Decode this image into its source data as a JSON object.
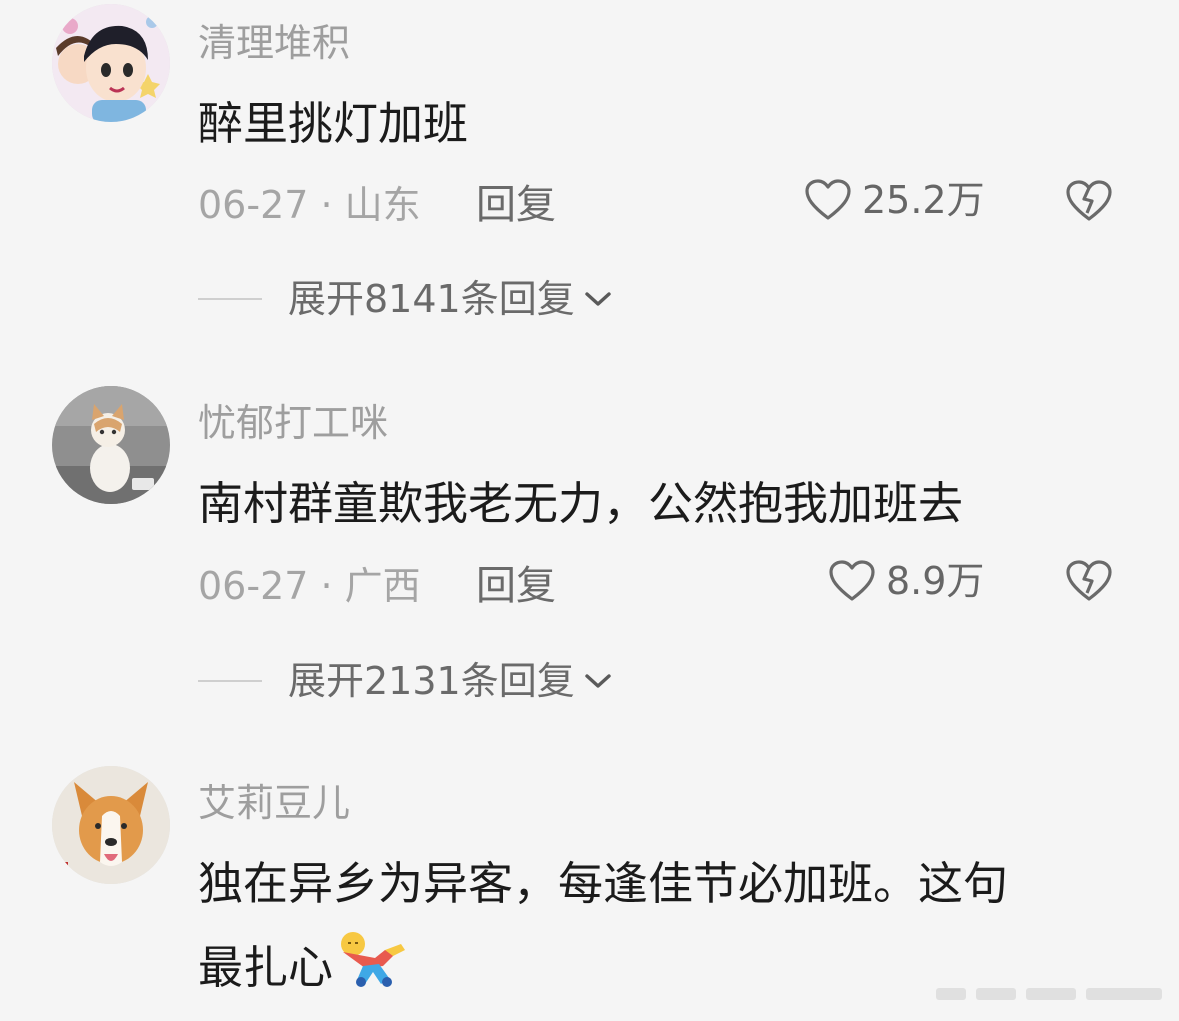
{
  "comments": [
    {
      "username": "清理堆积",
      "content": "醉里挑灯加班",
      "date_location": "06-27 · 山东",
      "reply_label": "回复",
      "likes": "25.2万",
      "expand_label": "展开8141条回复"
    },
    {
      "username": "忧郁打工咪",
      "content": "南村群童欺我老无力，公然抱我加班去",
      "date_location": "06-27 · 广西",
      "reply_label": "回复",
      "likes": "8.9万",
      "expand_label": "展开2131条回复"
    },
    {
      "username": "艾莉豆儿",
      "content_line1": "独在异乡为异客，每逢佳节必加班。这句",
      "content_line2": "最扎心"
    }
  ],
  "icons": {
    "like": "heart-outline-icon",
    "dislike": "broken-heart-icon",
    "expand": "chevron-down-icon",
    "emoji": "lying-down-emoji"
  },
  "colors": {
    "background": "#f5f5f5",
    "text_primary": "#1b1b1b",
    "text_secondary": "#9e9e9e"
  }
}
